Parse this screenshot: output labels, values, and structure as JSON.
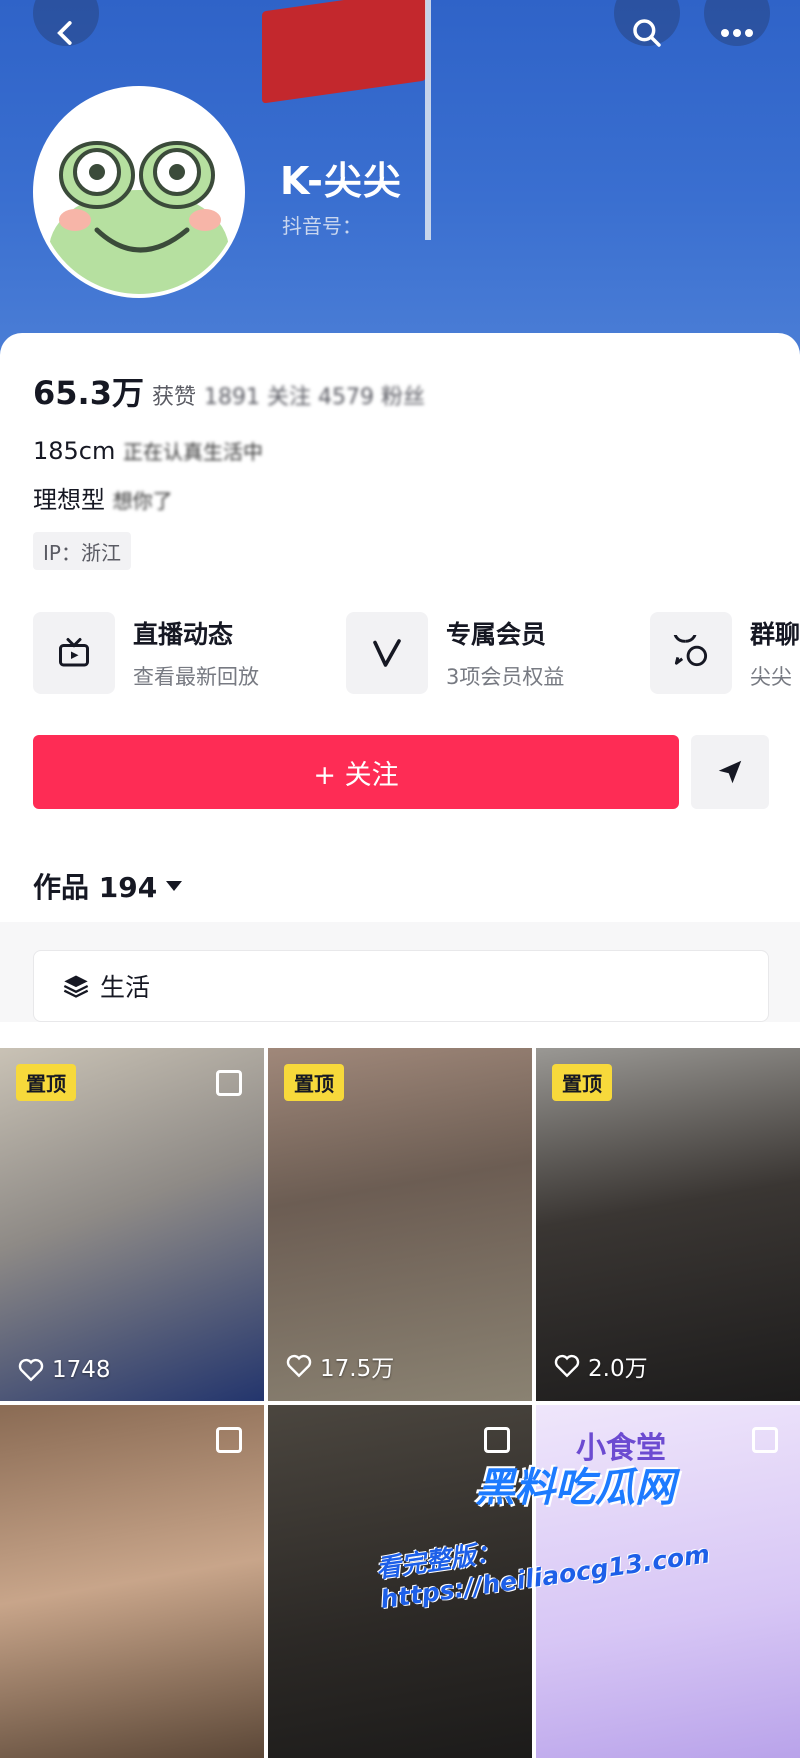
{
  "header": {
    "nickname": "K-尖尖",
    "douyin_id": "抖音号：",
    "icons": {
      "back": "chevron-left-icon",
      "search": "search-icon",
      "more": "more-horizontal-icon"
    }
  },
  "stats": {
    "likes_value": "65.3万",
    "likes_label": "获赞",
    "blurred": "1891 关注 4579 粉丝",
    "fans_label": "粉丝"
  },
  "bio": {
    "line1_prefix": "185cm",
    "line1_rest": "正在认真生活中",
    "line2_prefix": "理想型",
    "line2_rest": "想你了"
  },
  "ip": "IP：浙江",
  "features": [
    {
      "title": "直播动态",
      "subtitle": "查看最新回放",
      "icon": "tv-icon"
    },
    {
      "title": "专属会员",
      "subtitle": "3项会员权益",
      "icon": "v-badge-icon"
    },
    {
      "title": "群聊",
      "subtitle": "尖尖",
      "icon": "chat-bubbles-icon"
    }
  ],
  "actions": {
    "follow_label": "+ 关注",
    "share_icon": "send-icon"
  },
  "works": {
    "title": "作品 194"
  },
  "collection": {
    "label": "生活"
  },
  "tiles": [
    {
      "pinned": "置顶",
      "likes": "1748"
    },
    {
      "pinned": "置顶",
      "likes": "17.5万"
    },
    {
      "pinned": "置顶",
      "likes": "2.0万"
    },
    {
      "pinned": "",
      "likes": ""
    },
    {
      "pinned": "",
      "likes": ""
    },
    {
      "pinned": "",
      "likes": "",
      "caption": "小食堂"
    }
  ],
  "watermark": {
    "line1": "黑料吃瓜网",
    "line2": "看完整版：https://heiliaocg13.com"
  },
  "colors": {
    "accent": "#fe2c55",
    "header_blue": "#3a6fd0",
    "pin_yellow": "#f7d93b"
  }
}
